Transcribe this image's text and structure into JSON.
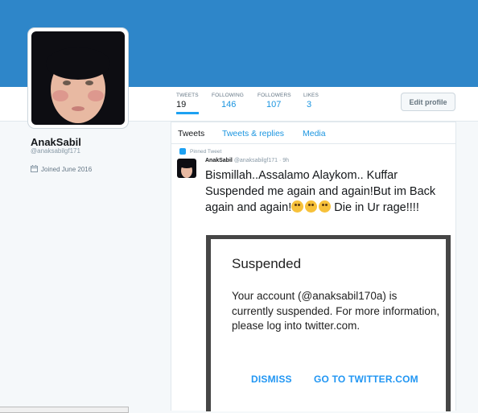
{
  "profile": {
    "name": "AnakSabil",
    "handle": "@anaksabilgf171",
    "joined": "Joined June 2016"
  },
  "stats": [
    {
      "label": "Tweets",
      "value": "19"
    },
    {
      "label": "Following",
      "value": "146"
    },
    {
      "label": "Followers",
      "value": "107"
    },
    {
      "label": "Likes",
      "value": "3"
    }
  ],
  "edit_profile_label": "Edit profile",
  "tabs": [
    "Tweets",
    "Tweets & replies",
    "Media"
  ],
  "tweet": {
    "pinned_label": "Pinned Tweet",
    "author": "AnakSabil",
    "meta": "@anaksabilgf171 · 9h",
    "text_part1": "Bismillah..Assalamo Alaykom.. Kuffar Suspended me again and again!But im Back again and again!",
    "text_part2": " Die in Ur rage!!!!",
    "emojis": [
      "face-with-tears-of-joy",
      "winking-face-with-tongue",
      "face-blowing-a-kiss"
    ]
  },
  "dialog": {
    "title": "Suspended",
    "body": "Your account (@anaksabil170a) is currently suspended. For more information, please log into twitter.com.",
    "dismiss": "DISMISS",
    "go": "GO TO TWITTER.COM"
  },
  "colors": {
    "banner": "#2e86c9",
    "link": "#1b95e0",
    "dialog_button": "#2196f3"
  }
}
